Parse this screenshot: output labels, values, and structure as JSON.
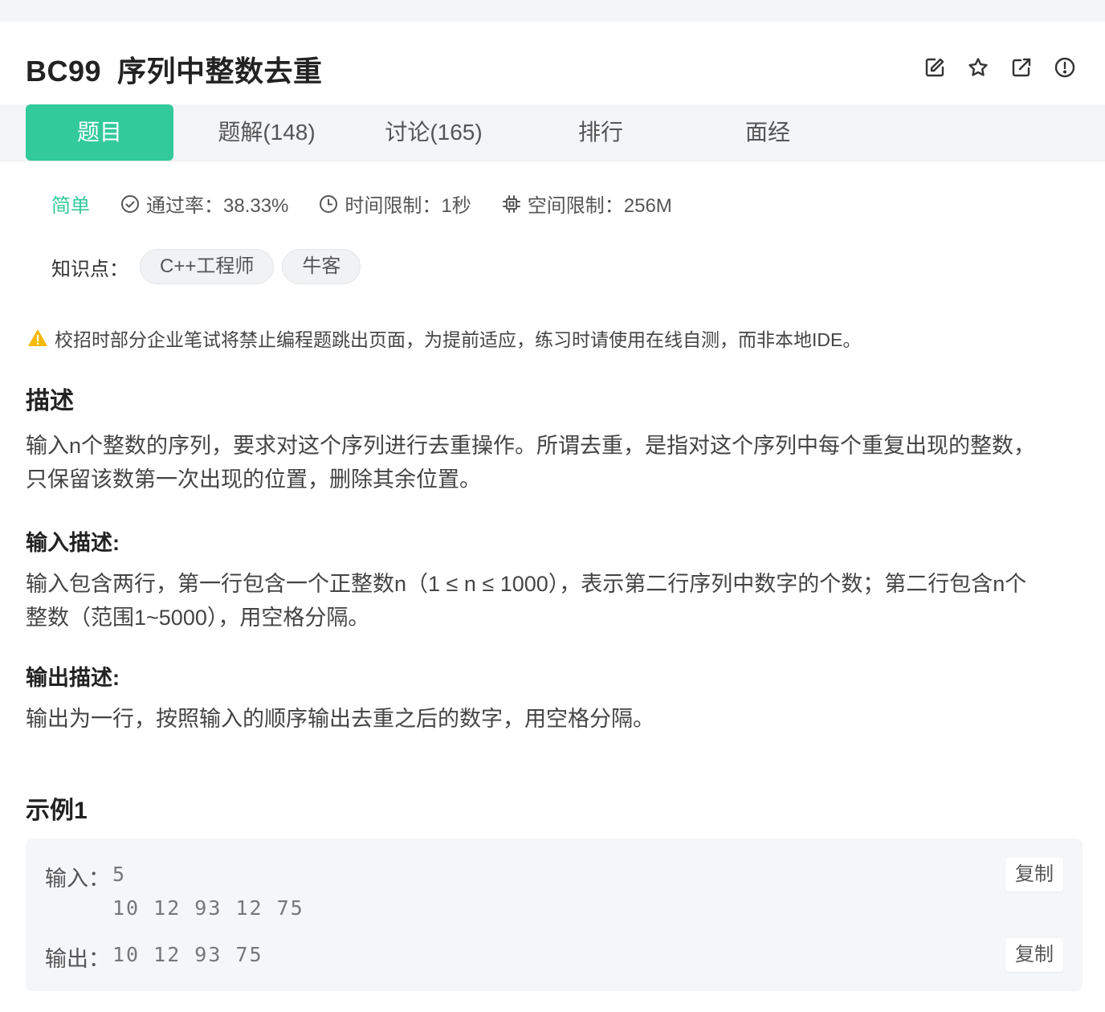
{
  "problem": {
    "id": "BC99",
    "title": "序列中整数去重"
  },
  "actions": [
    {
      "icon": "edit-icon"
    },
    {
      "icon": "star-icon"
    },
    {
      "icon": "share-icon"
    },
    {
      "icon": "report-icon"
    }
  ],
  "tabs": [
    {
      "label": "题目",
      "active": true
    },
    {
      "label": "题解(148)"
    },
    {
      "label": "讨论(165)"
    },
    {
      "label": "排行"
    },
    {
      "label": "面经"
    }
  ],
  "meta": {
    "difficulty": "简单",
    "pass_rate": "通过率：38.33%",
    "time_limit": "时间限制：1秒",
    "memory_limit": "空间限制：256M"
  },
  "knowledge": {
    "label": "知识点：",
    "tags": [
      "C++工程师",
      "牛客"
    ]
  },
  "warning": "校招时部分企业笔试将禁止编程题跳出页面，为提前适应，练习时请使用在线自测，而非本地IDE。",
  "description": {
    "heading": "描述",
    "line1": "输入n个整数的序列，要求对这个序列进行去重操作。所谓去重，是指对这个序列中每个重复出现的整数，",
    "line2": "只保留该数第一次出现的位置，删除其余位置。"
  },
  "input_desc": {
    "heading": "输入描述:",
    "line1": "输入包含两行，第一行包含一个正整数n（1 ≤ n ≤ 1000），表示第二行序列中数字的个数；第二行包含n个",
    "line2": "整数（范围1~5000），用空格分隔。"
  },
  "output_desc": {
    "heading": "输出描述:",
    "line1": "输出为一行，按照输入的顺序输出去重之后的数字，用空格分隔。"
  },
  "example": {
    "heading": "示例1",
    "input_label": "输入：",
    "input_line1": "5",
    "input_line2": "10 12 93 12 75",
    "output_label": "输出：",
    "output_line1": "10 12 93 75",
    "copy_label": "复制"
  },
  "colors": {
    "accent": "#32ca99",
    "warning": "#f5b800"
  }
}
